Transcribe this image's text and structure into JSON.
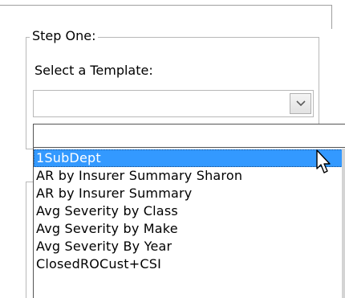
{
  "step": {
    "group_title": "Step One:",
    "select_label": "Select a Template:",
    "combo_value": ""
  },
  "dropdown": {
    "input_value": "",
    "items": [
      {
        "label": "1SubDept",
        "selected": true
      },
      {
        "label": "AR by Insurer Summary Sharon",
        "selected": false
      },
      {
        "label": "AR by Insurer Summary",
        "selected": false
      },
      {
        "label": "Avg Severity by Class",
        "selected": false
      },
      {
        "label": "Avg Severity by Make",
        "selected": false
      },
      {
        "label": "Avg Severity By Year",
        "selected": false
      },
      {
        "label": "ClosedROCust+CSI",
        "selected": false
      }
    ]
  },
  "colors": {
    "selection": "#3399ff",
    "selection_text": "#ffffff",
    "border": "#b8b8b8"
  },
  "icons": {
    "combo_arrow": "chevron-down-icon",
    "cursor": "mouse-pointer-icon"
  }
}
